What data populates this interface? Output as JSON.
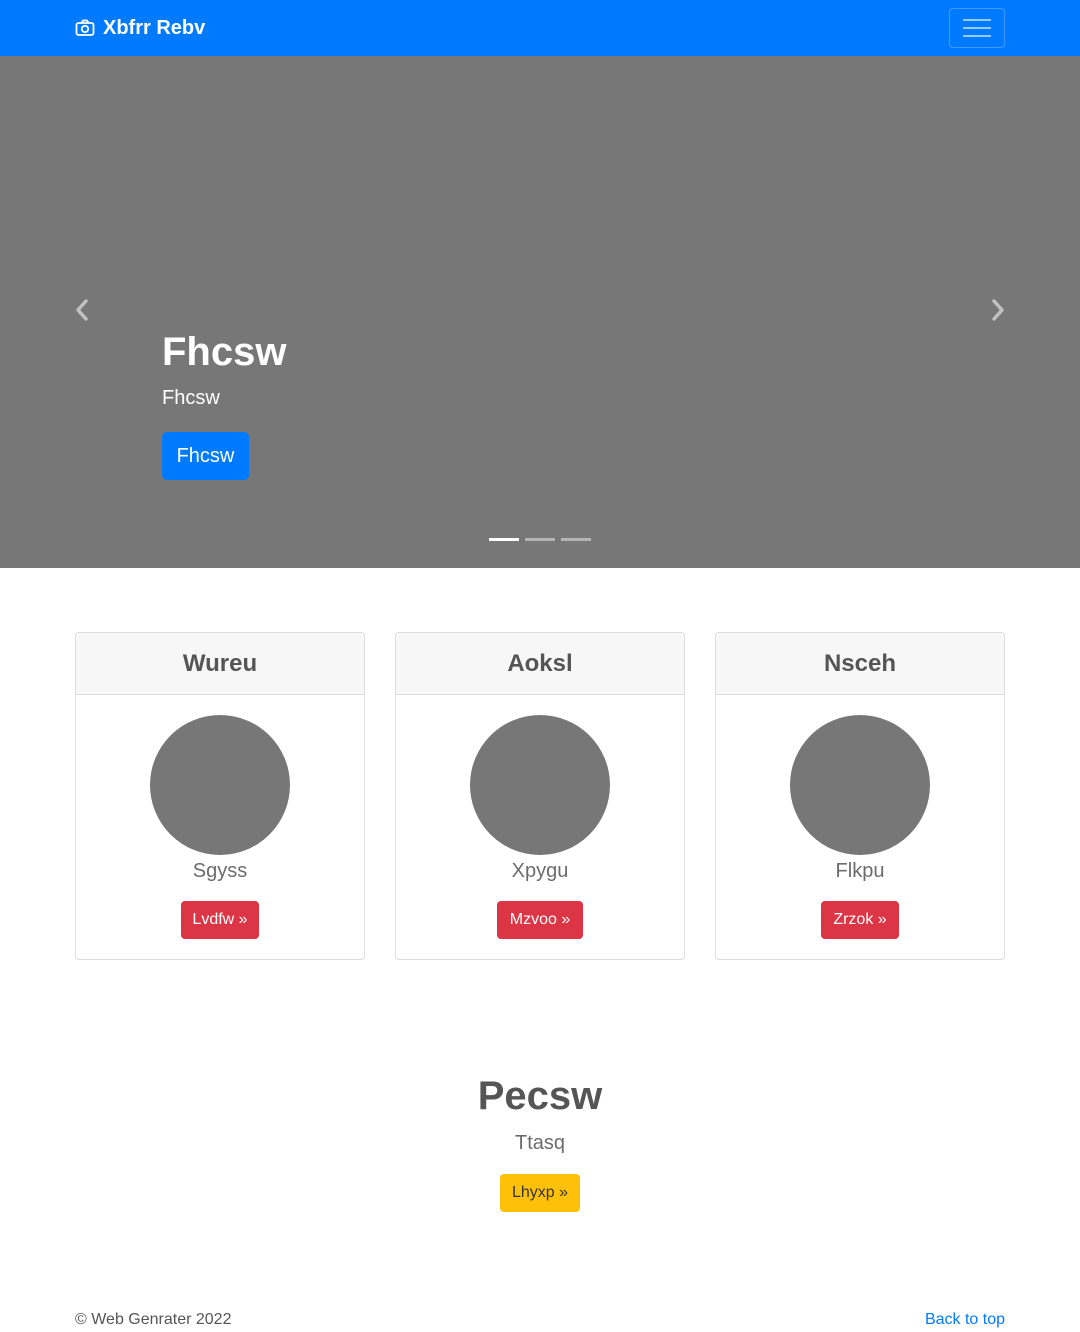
{
  "navbar": {
    "brand": "Xbfrr Rebv",
    "brand_icon": "camera-icon",
    "toggler_icon": "hamburger-menu-icon",
    "color": "#007bff"
  },
  "carousel": {
    "title": "Fhcsw",
    "subtitle": "Fhcsw",
    "button_label": "Fhcsw",
    "prev_icon": "chevron-left-icon",
    "next_icon": "chevron-right-icon",
    "slide_count": 3,
    "active_slide": 1,
    "background": "#777777"
  },
  "cards": [
    {
      "header": "Wureu",
      "text": "Sgyss",
      "button_label": "Lvdfw »"
    },
    {
      "header": "Aoksl",
      "text": "Xpygu",
      "button_label": "Mzvoo »"
    },
    {
      "header": "Nsceh",
      "text": "Flkpu",
      "button_label": "Zrzok »"
    }
  ],
  "section": {
    "title": "Pecsw",
    "text": "Ttasq",
    "button_label": "Lhyxp »"
  },
  "footer": {
    "copyright": "© Web Genrater 2022",
    "back_to_top": "Back to top"
  },
  "colors": {
    "primary": "#007bff",
    "danger": "#dc3545",
    "warning": "#ffc107",
    "placeholder": "#777777"
  }
}
